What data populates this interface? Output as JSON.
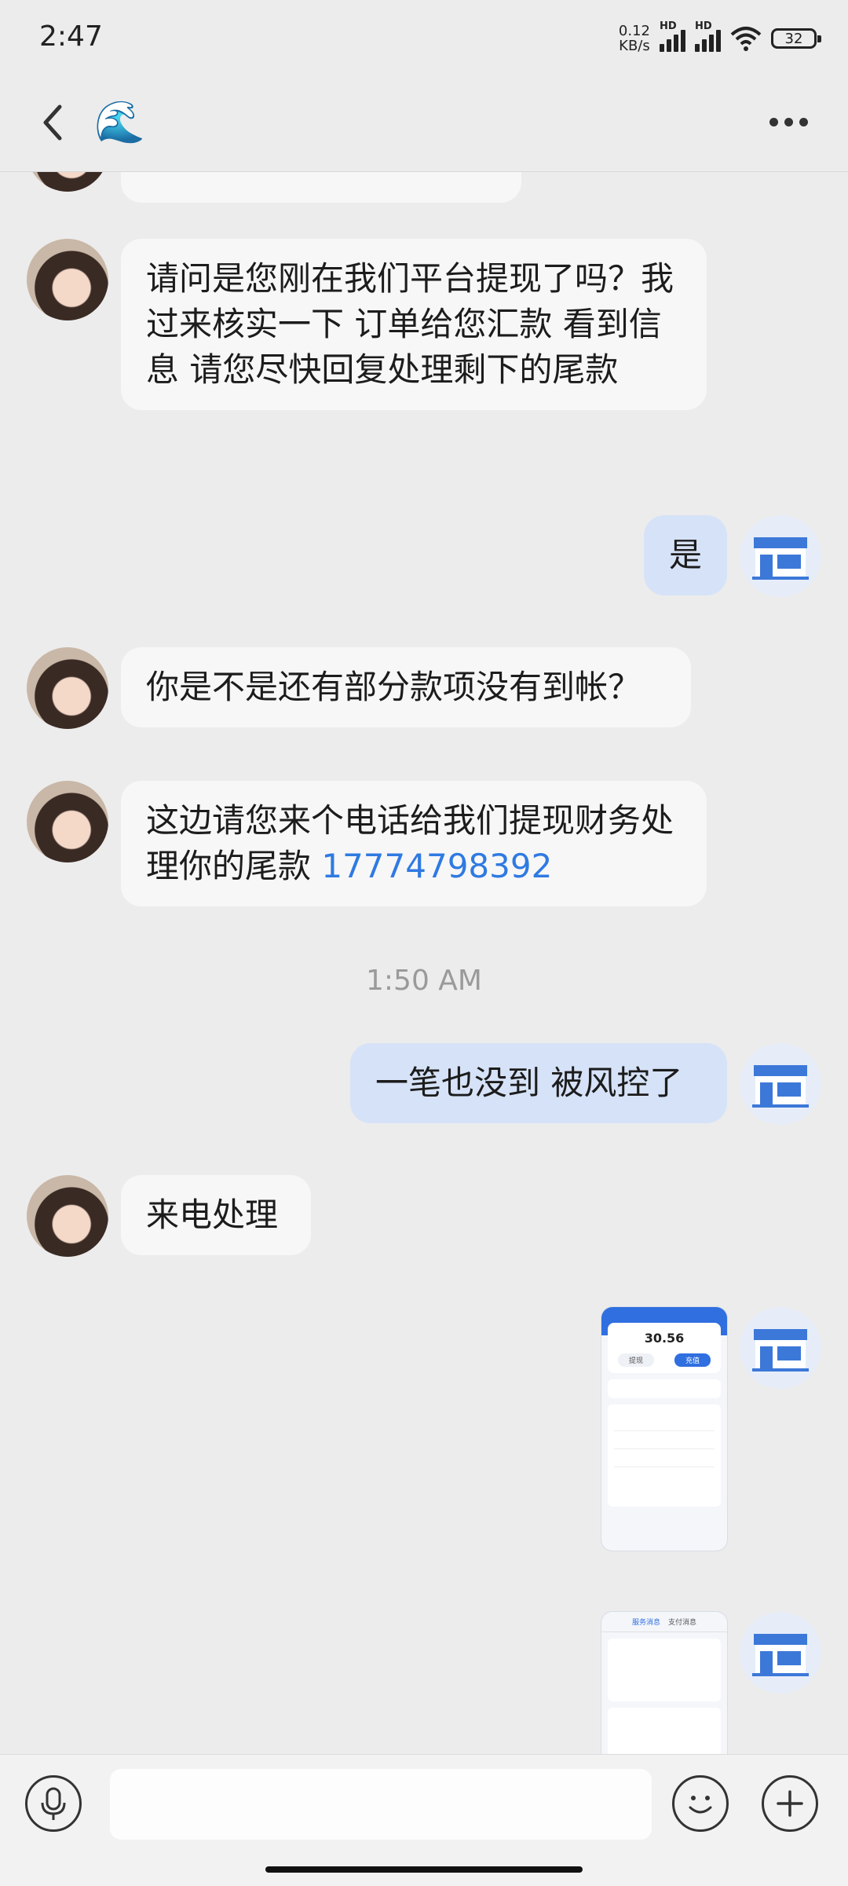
{
  "status": {
    "time": "2:47",
    "net_speed_value": "0.12",
    "net_speed_unit": "KB/s",
    "sim1_label": "HD",
    "sim2_label": "HD",
    "battery": "32"
  },
  "header": {
    "contact_avatar_emoji": "🌊",
    "back_icon": "chevron-left-icon",
    "more_icon": "more-horizontal-icon"
  },
  "messages": [
    {
      "side": "left",
      "text": "请问是您刚在我们平台提现了吗？我过来核实一下 订单给您汇款 看到信息 请您尽快回复处理剩下的尾款"
    },
    {
      "side": "right",
      "text": "是"
    },
    {
      "side": "left",
      "text": "你是不是还有部分款项没有到帐？"
    },
    {
      "side": "left",
      "text_prefix": "这边请您来个电话给我们提现财务处理你的尾款 ",
      "phone": "17774798392"
    },
    {
      "side": "right",
      "text": "一笔也没到 被风控了"
    },
    {
      "side": "left",
      "text": "来电处理"
    }
  ],
  "timestamp": "1:50 AM",
  "screenshot1": {
    "balance": "30.56",
    "btn_left": "提现",
    "btn_right": "充值"
  },
  "screenshot2": {
    "tab1": "服务消息",
    "tab2": "支付消息"
  },
  "input": {
    "placeholder": ""
  },
  "colors": {
    "background": "#ececec",
    "bubble_left": "#f7f7f7",
    "bubble_right": "#d6e2f7",
    "link": "#2f7ae2"
  }
}
